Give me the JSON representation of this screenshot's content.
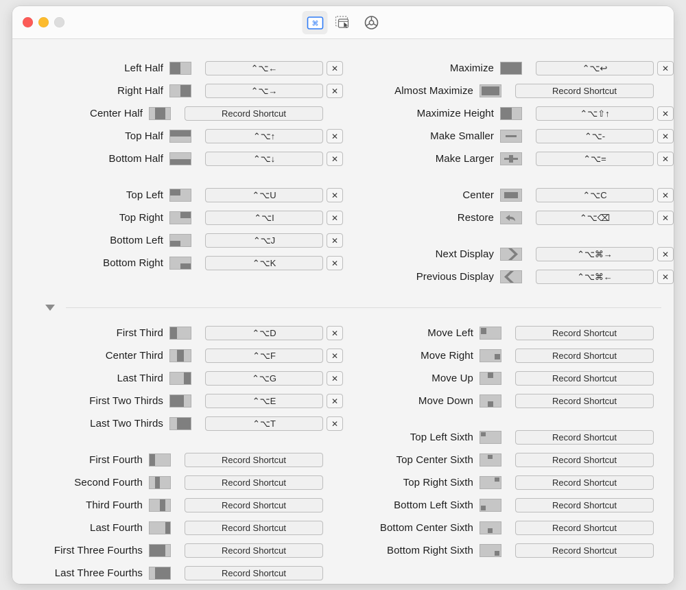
{
  "window": {
    "traffic_lights": {
      "close": "close",
      "minimize": "minimize",
      "zoom": "zoom"
    },
    "colors": {
      "close": "#fc5b57",
      "minimize": "#fcbb2e",
      "zoom": "#dddddd",
      "accent": "#2f7cf6",
      "thumb_fill": "#7f7f7f",
      "thumb_bg": "#c6c6c6",
      "window_bg": "#f4f4f4"
    }
  },
  "toolbar": {
    "items": [
      {
        "name": "keyboard-shortcuts-tab",
        "icon": "keyboard-shortcut-icon",
        "active": true
      },
      {
        "name": "snap-areas-tab",
        "icon": "drag-snap-icon",
        "active": false
      },
      {
        "name": "general-settings-tab",
        "icon": "gear-icon",
        "active": false
      }
    ]
  },
  "labels": {
    "record_shortcut": "Record Shortcut",
    "clear": "✕"
  },
  "left_column": {
    "groups": [
      {
        "name": "halves",
        "rows": [
          {
            "label": "Left Half",
            "thumb": "left-half",
            "shortcut": "⌃⌥←"
          },
          {
            "label": "Right Half",
            "thumb": "right-half",
            "shortcut": "⌃⌥→"
          },
          {
            "label": "Center Half",
            "thumb": "center-half",
            "shortcut": ""
          },
          {
            "label": "Top Half",
            "thumb": "top-half",
            "shortcut": "⌃⌥↑"
          },
          {
            "label": "Bottom Half",
            "thumb": "bottom-half",
            "shortcut": "⌃⌥↓"
          }
        ]
      },
      {
        "name": "quadrants",
        "rows": [
          {
            "label": "Top Left",
            "thumb": "top-left",
            "shortcut": "⌃⌥U"
          },
          {
            "label": "Top Right",
            "thumb": "top-right",
            "shortcut": "⌃⌥I"
          },
          {
            "label": "Bottom Left",
            "thumb": "bottom-left",
            "shortcut": "⌃⌥J"
          },
          {
            "label": "Bottom Right",
            "thumb": "bottom-right",
            "shortcut": "⌃⌥K"
          }
        ]
      }
    ]
  },
  "right_column": {
    "groups": [
      {
        "name": "maximize-resize",
        "rows": [
          {
            "label": "Maximize",
            "thumb": "maximize",
            "shortcut": "⌃⌥↩"
          },
          {
            "label": "Almost Maximize",
            "thumb": "almost-maximize",
            "shortcut": ""
          },
          {
            "label": "Maximize Height",
            "thumb": "maximize-height",
            "shortcut": "⌃⌥⇧↑"
          },
          {
            "label": "Make Smaller",
            "thumb": "make-smaller",
            "shortcut": "⌃⌥-"
          },
          {
            "label": "Make Larger",
            "thumb": "make-larger",
            "shortcut": "⌃⌥="
          }
        ]
      },
      {
        "name": "center-restore",
        "rows": [
          {
            "label": "Center",
            "thumb": "center",
            "shortcut": "⌃⌥C"
          },
          {
            "label": "Restore",
            "thumb": "restore",
            "shortcut": "⌃⌥⌫"
          }
        ]
      },
      {
        "name": "displays",
        "rows": [
          {
            "label": "Next Display",
            "thumb": "next-display",
            "shortcut": "⌃⌥⌘→"
          },
          {
            "label": "Previous Display",
            "thumb": "previous-display",
            "shortcut": "⌃⌥⌘←"
          }
        ]
      }
    ]
  },
  "left_column_lower": {
    "groups": [
      {
        "name": "thirds",
        "rows": [
          {
            "label": "First Third",
            "thumb": "first-third",
            "shortcut": "⌃⌥D"
          },
          {
            "label": "Center Third",
            "thumb": "center-third",
            "shortcut": "⌃⌥F"
          },
          {
            "label": "Last Third",
            "thumb": "last-third",
            "shortcut": "⌃⌥G"
          },
          {
            "label": "First Two Thirds",
            "thumb": "first-two-thirds",
            "shortcut": "⌃⌥E"
          },
          {
            "label": "Last Two Thirds",
            "thumb": "last-two-thirds",
            "shortcut": "⌃⌥T"
          }
        ]
      },
      {
        "name": "fourths",
        "rows": [
          {
            "label": "First Fourth",
            "thumb": "first-fourth",
            "shortcut": ""
          },
          {
            "label": "Second Fourth",
            "thumb": "second-fourth",
            "shortcut": ""
          },
          {
            "label": "Third Fourth",
            "thumb": "third-fourth",
            "shortcut": ""
          },
          {
            "label": "Last Fourth",
            "thumb": "last-fourth",
            "shortcut": ""
          },
          {
            "label": "First Three Fourths",
            "thumb": "first-three-fourths",
            "shortcut": ""
          },
          {
            "label": "Last Three Fourths",
            "thumb": "last-three-fourths",
            "shortcut": ""
          }
        ]
      }
    ]
  },
  "right_column_lower": {
    "groups": [
      {
        "name": "move",
        "rows": [
          {
            "label": "Move Left",
            "thumb": "move-left",
            "shortcut": ""
          },
          {
            "label": "Move Right",
            "thumb": "move-right",
            "shortcut": ""
          },
          {
            "label": "Move Up",
            "thumb": "move-up",
            "shortcut": ""
          },
          {
            "label": "Move Down",
            "thumb": "move-down",
            "shortcut": ""
          }
        ]
      },
      {
        "name": "sixths",
        "rows": [
          {
            "label": "Top Left Sixth",
            "thumb": "top-left-sixth",
            "shortcut": ""
          },
          {
            "label": "Top Center Sixth",
            "thumb": "top-center-sixth",
            "shortcut": ""
          },
          {
            "label": "Top Right Sixth",
            "thumb": "top-right-sixth",
            "shortcut": ""
          },
          {
            "label": "Bottom Left Sixth",
            "thumb": "bottom-left-sixth",
            "shortcut": ""
          },
          {
            "label": "Bottom Center Sixth",
            "thumb": "bottom-center-sixth",
            "shortcut": ""
          },
          {
            "label": "Bottom Right Sixth",
            "thumb": "bottom-right-sixth",
            "shortcut": ""
          }
        ]
      }
    ]
  }
}
